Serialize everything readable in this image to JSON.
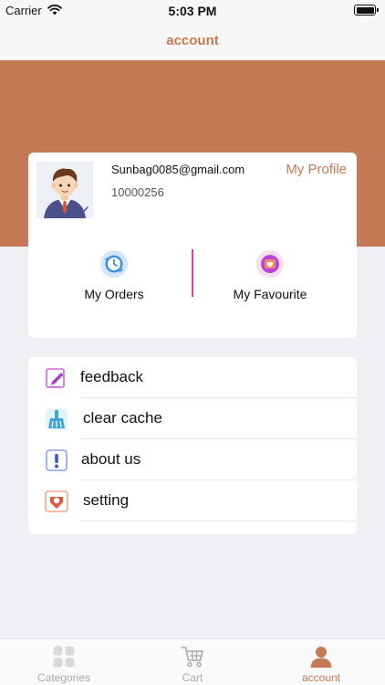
{
  "status": {
    "carrier": "Carrier",
    "time": "5:03 PM"
  },
  "nav": {
    "title": "account"
  },
  "colors": {
    "accent": "#c47a55",
    "divider": "#e0409b",
    "tab_inactive": "#a9a9a9",
    "page_bg": "#efeff4"
  },
  "profile": {
    "email": "Sunbag0085@gmail.com",
    "user_id": "10000256",
    "link_label": "My Profile"
  },
  "shortcuts": {
    "orders": {
      "label": "My Orders",
      "icon": "clock-icon"
    },
    "favourite": {
      "label": "My Favourite",
      "icon": "heart-icon"
    }
  },
  "menu": {
    "items": [
      {
        "label": "feedback",
        "icon": "edit-icon"
      },
      {
        "label": "clear cache",
        "icon": "broom-icon"
      },
      {
        "label": "about us",
        "icon": "info-icon"
      },
      {
        "label": "setting",
        "icon": "settings-icon"
      }
    ]
  },
  "tabs": [
    {
      "label": "Categories",
      "icon": "grid-icon",
      "active": false
    },
    {
      "label": "Cart",
      "icon": "cart-icon",
      "active": false
    },
    {
      "label": "account",
      "icon": "person-icon",
      "active": true
    }
  ]
}
